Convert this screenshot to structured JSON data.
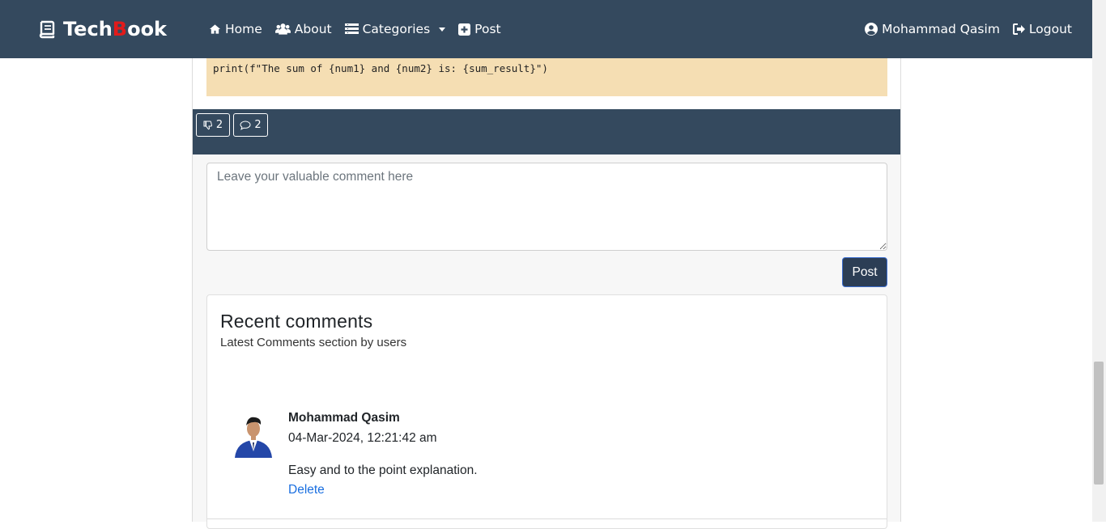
{
  "nav": {
    "brand_prefix": "Tech",
    "brand_b": "B",
    "brand_suffix": "ook",
    "links": {
      "home": "Home",
      "about": "About",
      "categories": "Categories",
      "post": "Post"
    },
    "user_name": "Mohammad Qasim",
    "logout": "Logout"
  },
  "post": {
    "code_line": "print(f\"The sum of {num1} and {num2} is: {sum_result}\")",
    "dislike_count": "2",
    "comment_count": "2"
  },
  "comment_form": {
    "placeholder": "Leave your valuable comment here",
    "submit_label": "Post"
  },
  "recent_comments": {
    "title": "Recent comments",
    "subtitle": "Latest Comments section by users",
    "items": [
      {
        "author": "Mohammad Qasim",
        "date": "04-Mar-2024, 12:21:42 am",
        "text": "Easy and to the point explanation.",
        "delete_label": "Delete"
      }
    ]
  },
  "colors": {
    "navbar": "#34495e",
    "brand_accent": "#e21b1b",
    "code_bg": "#f5deb3",
    "link": "#1a6fe0"
  }
}
